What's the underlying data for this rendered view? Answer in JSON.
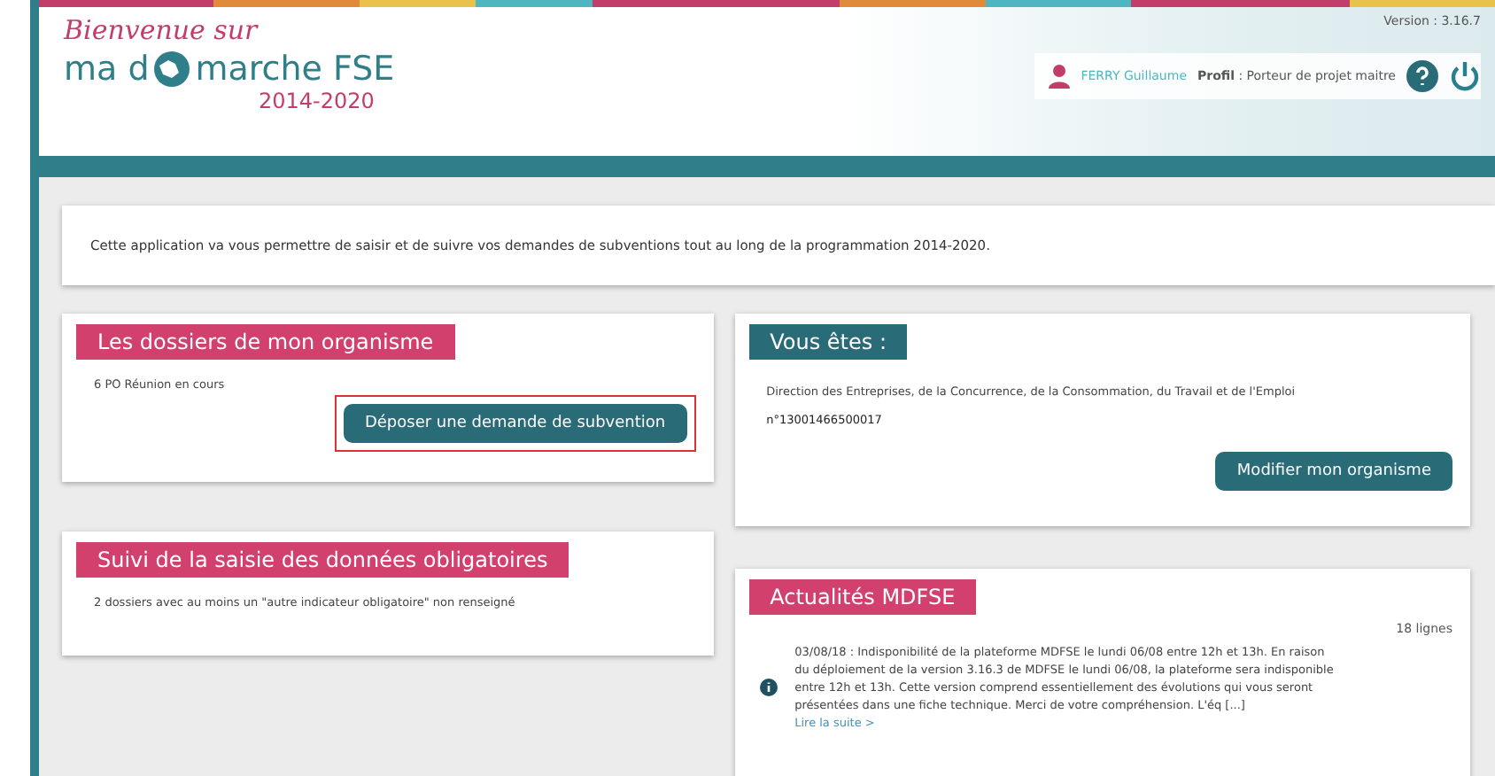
{
  "header": {
    "welcome": "Bienvenue sur",
    "logo_left": "ma d",
    "logo_right": "marche FSE",
    "years": "2014-2020",
    "version": "Version : 3.16.7",
    "user": "FERRY Guillaume",
    "profile_label": "Profil",
    "profile_value": " : Porteur de projet maitre"
  },
  "intro": "Cette application va vous permettre de saisir et de suivre vos demandes de subventions tout au long de la programmation 2014-2020.",
  "left_cards": [
    {
      "title": "Les dossiers de mon organisme",
      "text": "6 PO Réunion en cours",
      "button": {
        "label": "Déposer une demande de subvention",
        "highlighted": true
      }
    },
    {
      "title": "Suivi de la saisie des données obligatoires",
      "text": "2 dossiers avec au moins un \"autre indicateur obligatoire\" non renseigné"
    }
  ],
  "vous_etes": {
    "title": "Vous êtes :",
    "organisation": "Direction des Entreprises, de la Concurrence, de la Consommation, du Travail et de l'Emploi",
    "number": "n°13001466500017",
    "button": "Modifier mon organisme"
  },
  "news": {
    "title": "Actualités MDFSE",
    "count": "18 lignes",
    "items": [
      {
        "text": "03/08/18 : Indisponibilité de la plateforme MDFSE le lundi 06/08 entre 12h et 13h. En raison du déploiement de la version 3.16.3 de MDFSE le lundi 06/08, la plateforme sera indisponible entre 12h et 13h. Cette version comprend essentiellement des évolutions qui vous seront présentées dans une fiche technique. Merci de votre compréhension. L'éq [...]",
        "link": "Lire la suite >"
      }
    ]
  }
}
